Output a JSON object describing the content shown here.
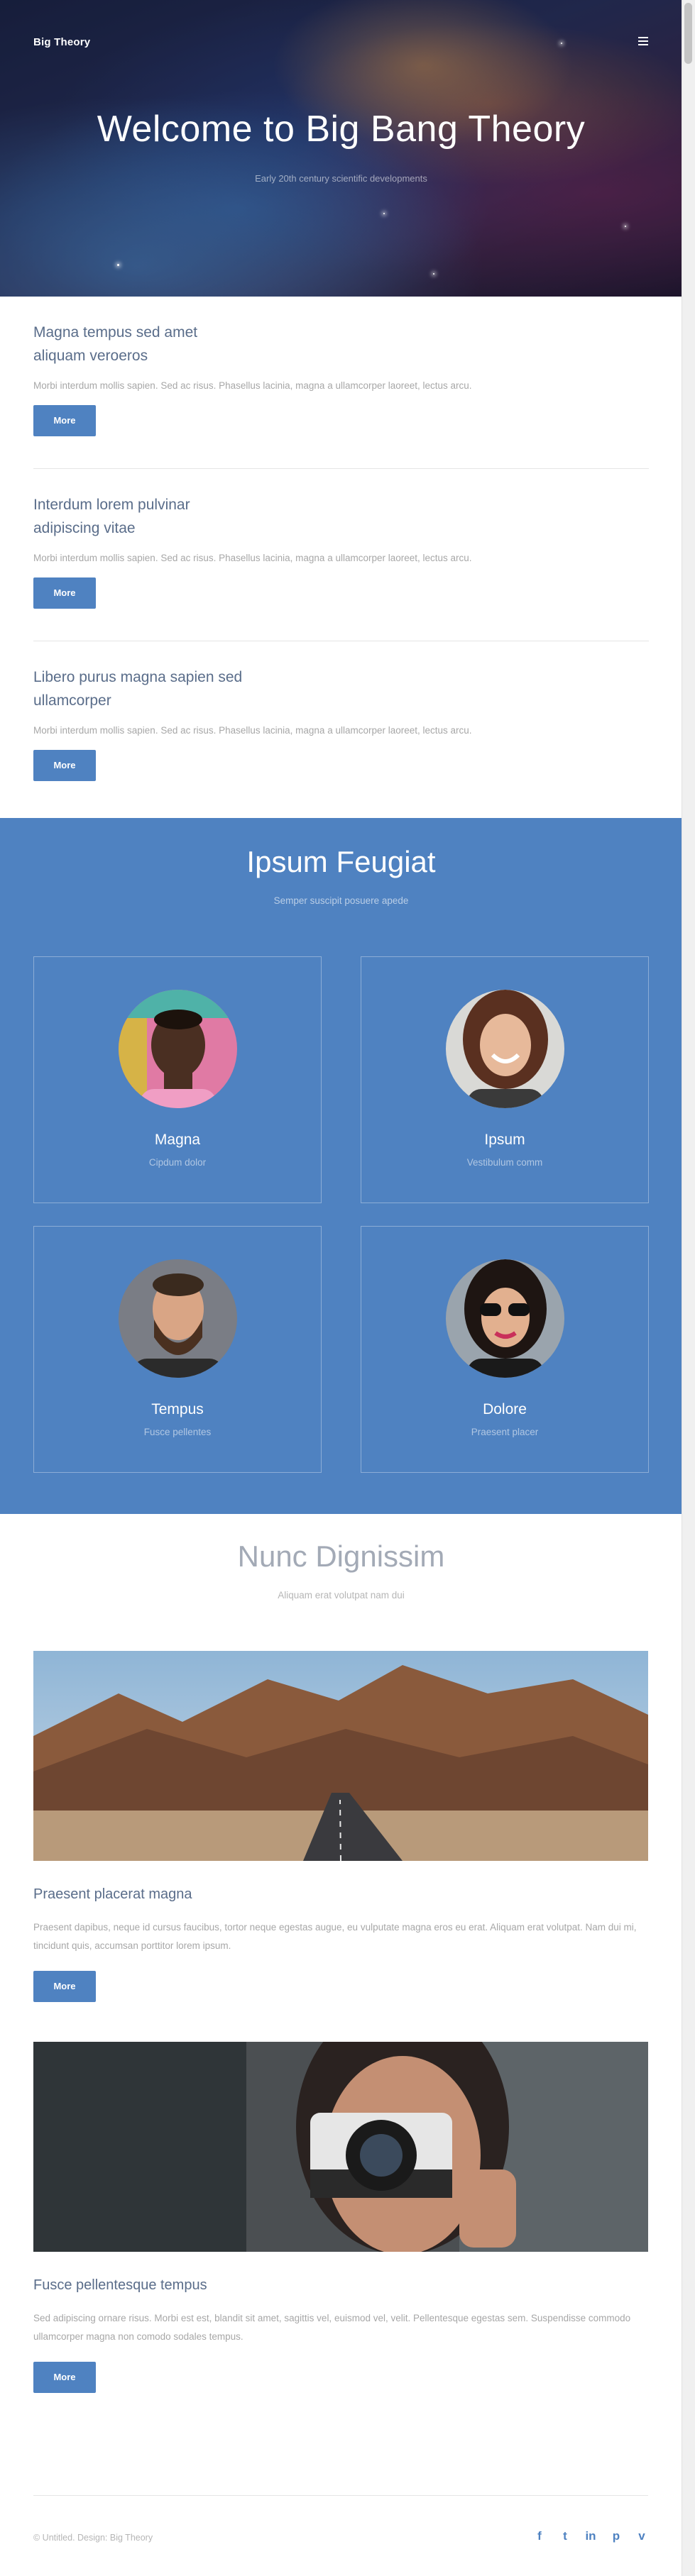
{
  "header": {
    "brand": "Big Theory",
    "menu_icon": "hamburger-menu-icon"
  },
  "hero": {
    "title": "Welcome to Big Bang Theory",
    "subtitle": "Early 20th century scientific developments"
  },
  "intro": {
    "items": [
      {
        "title": "Magna tempus sed amet aliquam veroeros",
        "text": "Morbi interdum mollis sapien. Sed ac risus. Phasellus lacinia, magna a ullamcorper laoreet, lectus arcu.",
        "button": "More"
      },
      {
        "title": "Interdum lorem pulvinar adipiscing vitae",
        "text": "Morbi interdum mollis sapien. Sed ac risus. Phasellus lacinia, magna a ullamcorper laoreet, lectus arcu.",
        "button": "More"
      },
      {
        "title": "Libero purus magna sapien sed ullamcorper",
        "text": "Morbi interdum mollis sapien. Sed ac risus. Phasellus lacinia, magna a ullamcorper laoreet, lectus arcu.",
        "button": "More"
      }
    ]
  },
  "team": {
    "title": "Ipsum Feugiat",
    "subtitle": "Semper suscipit posuere apede",
    "members": [
      {
        "name": "Magna",
        "role": "Cipdum dolor"
      },
      {
        "name": "Ipsum",
        "role": "Vestibulum comm"
      },
      {
        "name": "Tempus",
        "role": "Fusce pellentes"
      },
      {
        "name": "Dolore",
        "role": "Praesent placer"
      }
    ]
  },
  "posts": {
    "title": "Nunc Dignissim",
    "subtitle": "Aliquam erat volutpat nam dui",
    "items": [
      {
        "title": "Praesent placerat magna",
        "text": "Praesent dapibus, neque id cursus faucibus, tortor neque egestas augue, eu vulputate magna eros eu erat. Aliquam erat volutpat. Nam dui mi, tincidunt quis, accumsan porttitor lorem ipsum.",
        "button": "More"
      },
      {
        "title": "Fusce pellentesque tempus",
        "text": "Sed adipiscing ornare risus. Morbi est est, blandit sit amet, sagittis vel, euismod vel, velit. Pellentesque egestas sem. Suspendisse commodo ullamcorper magna non comodo sodales tempus.",
        "button": "More"
      }
    ]
  },
  "footer": {
    "copyright": "© Untitled. Design: Big Theory",
    "socials": [
      {
        "icon": "facebook-icon",
        "glyph": "f"
      },
      {
        "icon": "twitter-icon",
        "glyph": "t"
      },
      {
        "icon": "linkedin-icon",
        "glyph": "in"
      },
      {
        "icon": "pinterest-icon",
        "glyph": "p"
      },
      {
        "icon": "vimeo-icon",
        "glyph": "v"
      }
    ]
  },
  "colors": {
    "accent": "#4f82c1",
    "heading": "#5a6d8a",
    "muted": "#a7a7a7"
  }
}
